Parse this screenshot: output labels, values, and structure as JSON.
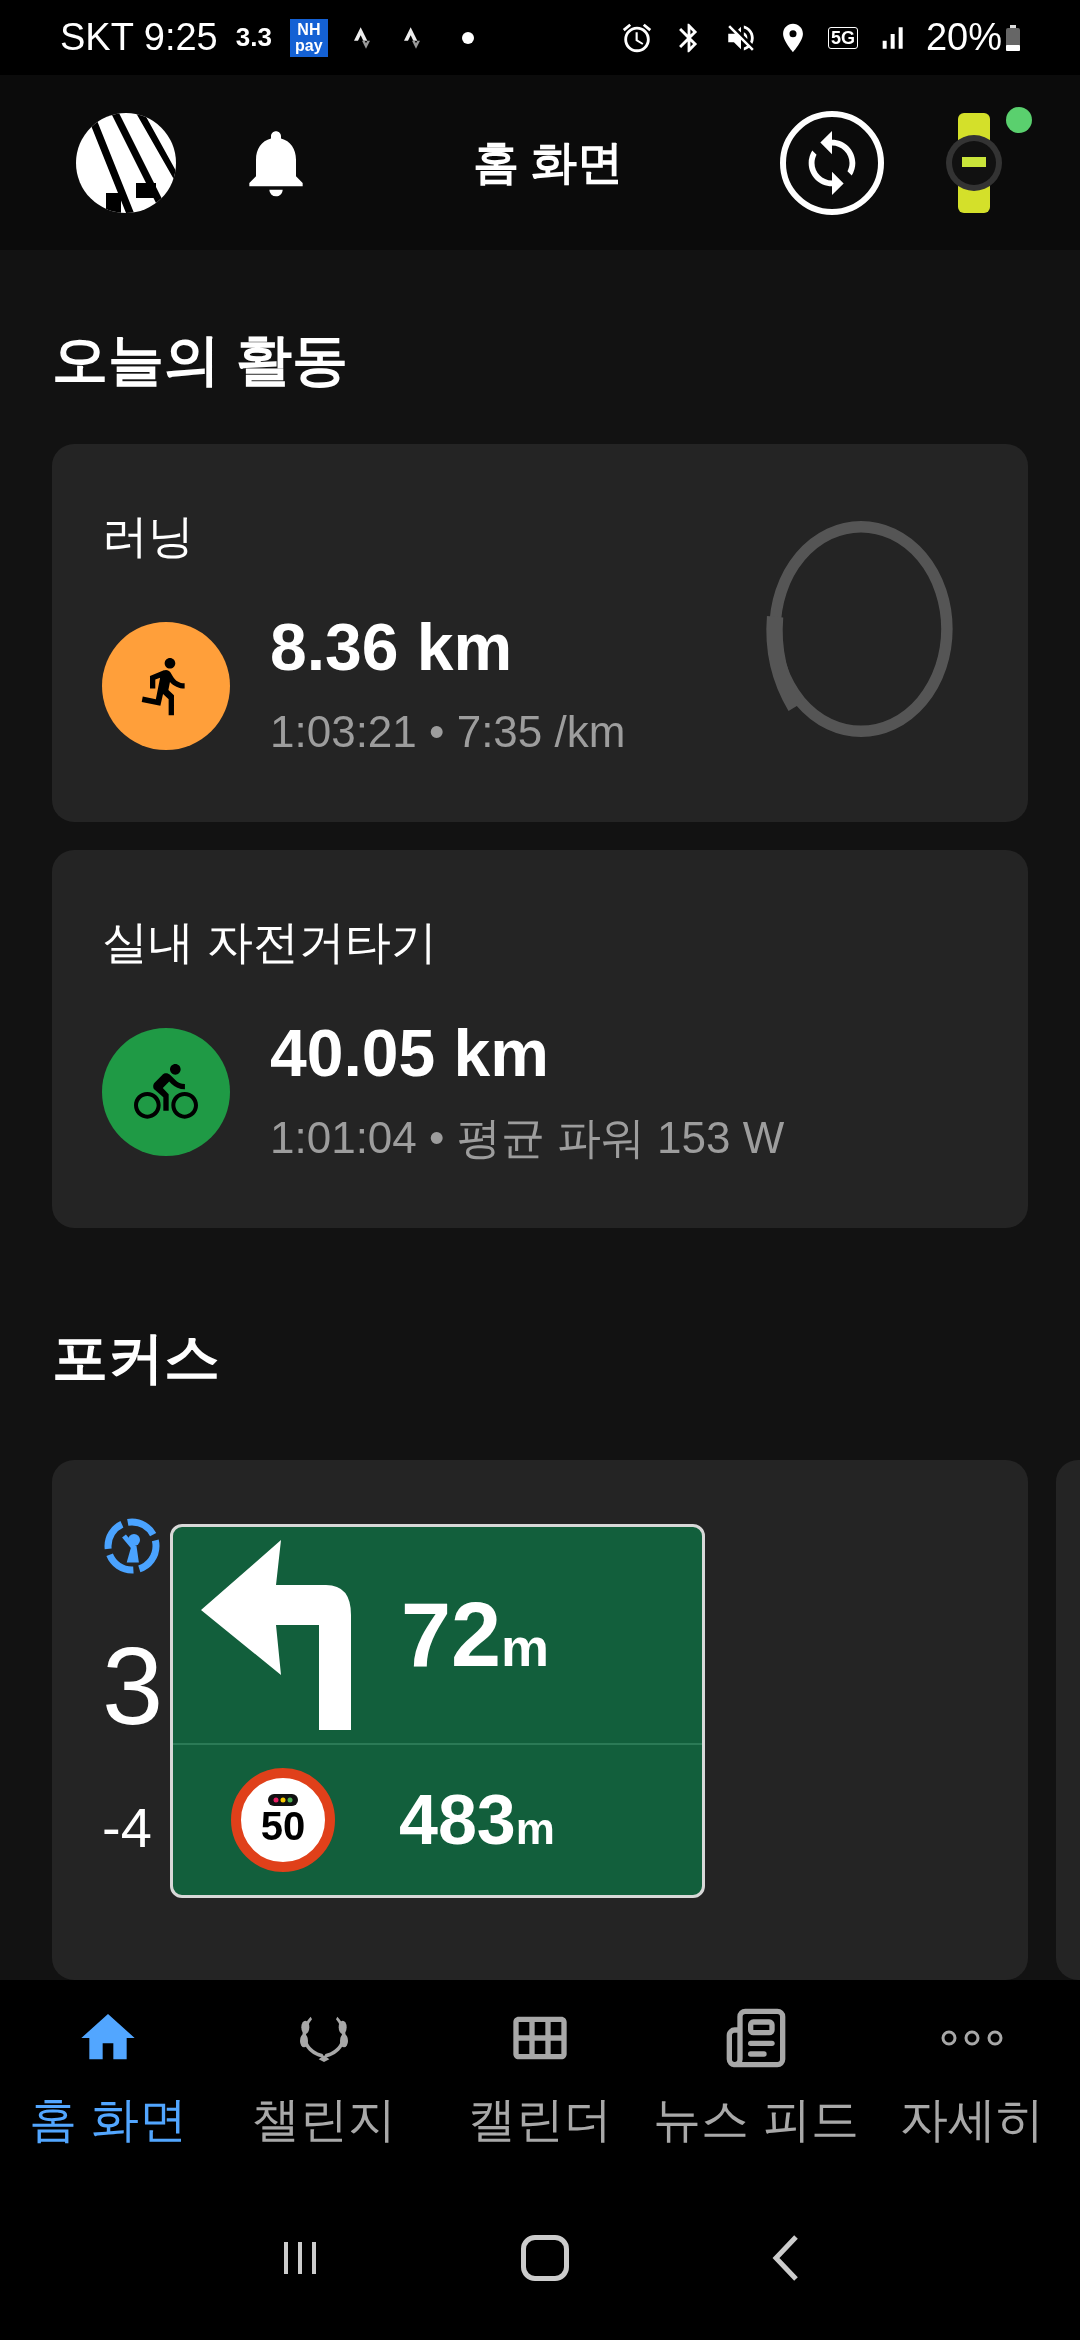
{
  "status_bar": {
    "carrier_time": "SKT 9:25",
    "badge": "3.3",
    "pay_logo": "NH pay",
    "network": "5G",
    "battery": "20%"
  },
  "header": {
    "title": "홈 화면"
  },
  "today": {
    "title": "오늘의 활동",
    "activities": [
      {
        "kind": "running",
        "name": "러닝",
        "distance": "8.36 km",
        "details": "1:03:21 • 7:35 /km",
        "color": "#ff9f3a"
      },
      {
        "kind": "cycling",
        "name": "실내 자전거타기",
        "distance": "40.05 km",
        "details": "1:01:04 • 평균 파워 153 W",
        "color": "#1f9a45"
      }
    ]
  },
  "focus": {
    "title": "포커스",
    "card": {
      "value": "3",
      "drained": "-4"
    }
  },
  "navigation_overlay": {
    "turn_distance": "72",
    "turn_unit": "m",
    "speed_limit": "50",
    "camera_distance": "483",
    "camera_unit": "m"
  },
  "bottom_nav": [
    {
      "kind": "home",
      "label": "홈 화면",
      "selected": true
    },
    {
      "kind": "challenge",
      "label": "챌린지",
      "selected": false
    },
    {
      "kind": "calendar",
      "label": "캘린더",
      "selected": false
    },
    {
      "kind": "news",
      "label": "뉴스 피드",
      "selected": false
    },
    {
      "kind": "more",
      "label": "자세히",
      "selected": false
    }
  ]
}
